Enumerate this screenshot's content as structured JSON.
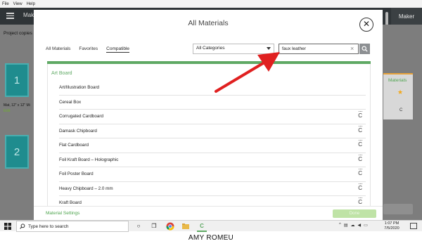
{
  "menu": {
    "file": "File",
    "view": "View",
    "help": "Help"
  },
  "app": {
    "title_fragment": "Make",
    "right_label": "Maker"
  },
  "canvas": {
    "project_copies": "Project copies",
    "mat1_number": "1",
    "mat2_number": "2",
    "mat_label": "Mat, 12\" x 12\" Mi",
    "edit": "Edit",
    "right_materials": "Materials",
    "right_c": "C"
  },
  "dialog": {
    "title": "All Materials",
    "close_icon": "close-icon",
    "tabs": [
      {
        "label": "All Materials",
        "active": false
      },
      {
        "label": "Favorites",
        "active": false
      },
      {
        "label": "Compatible",
        "active": true
      }
    ],
    "category_select": "All Categories",
    "search_value": "faux leather",
    "search_clear": "×",
    "section_title": "Art Board",
    "materials": [
      {
        "name": "Art/Illustration Board",
        "icon": ""
      },
      {
        "name": "Cereal Box",
        "icon": ""
      },
      {
        "name": "Corrugated Cardboard",
        "icon": "C"
      },
      {
        "name": "Damask Chipboard",
        "icon": "C"
      },
      {
        "name": "Flat Cardboard",
        "icon": "C"
      },
      {
        "name": "Foil Kraft Board – Holographic",
        "icon": "C"
      },
      {
        "name": "Foil Poster Board",
        "icon": "C"
      },
      {
        "name": "Heavy Chipboard – 2.0 mm",
        "icon": "C"
      },
      {
        "name": "Kraft Board",
        "icon": "C"
      }
    ],
    "material_settings": "Material Settings",
    "done": "Done"
  },
  "taskbar": {
    "search_placeholder": "Type here to search",
    "time": "1:07 PM",
    "date": "7/5/2020"
  },
  "watermark": "AMY ROMEU",
  "colors": {
    "accent_green": "#5fa964",
    "arrow_red": "#e02020",
    "dark_bar": "#2f3437"
  }
}
